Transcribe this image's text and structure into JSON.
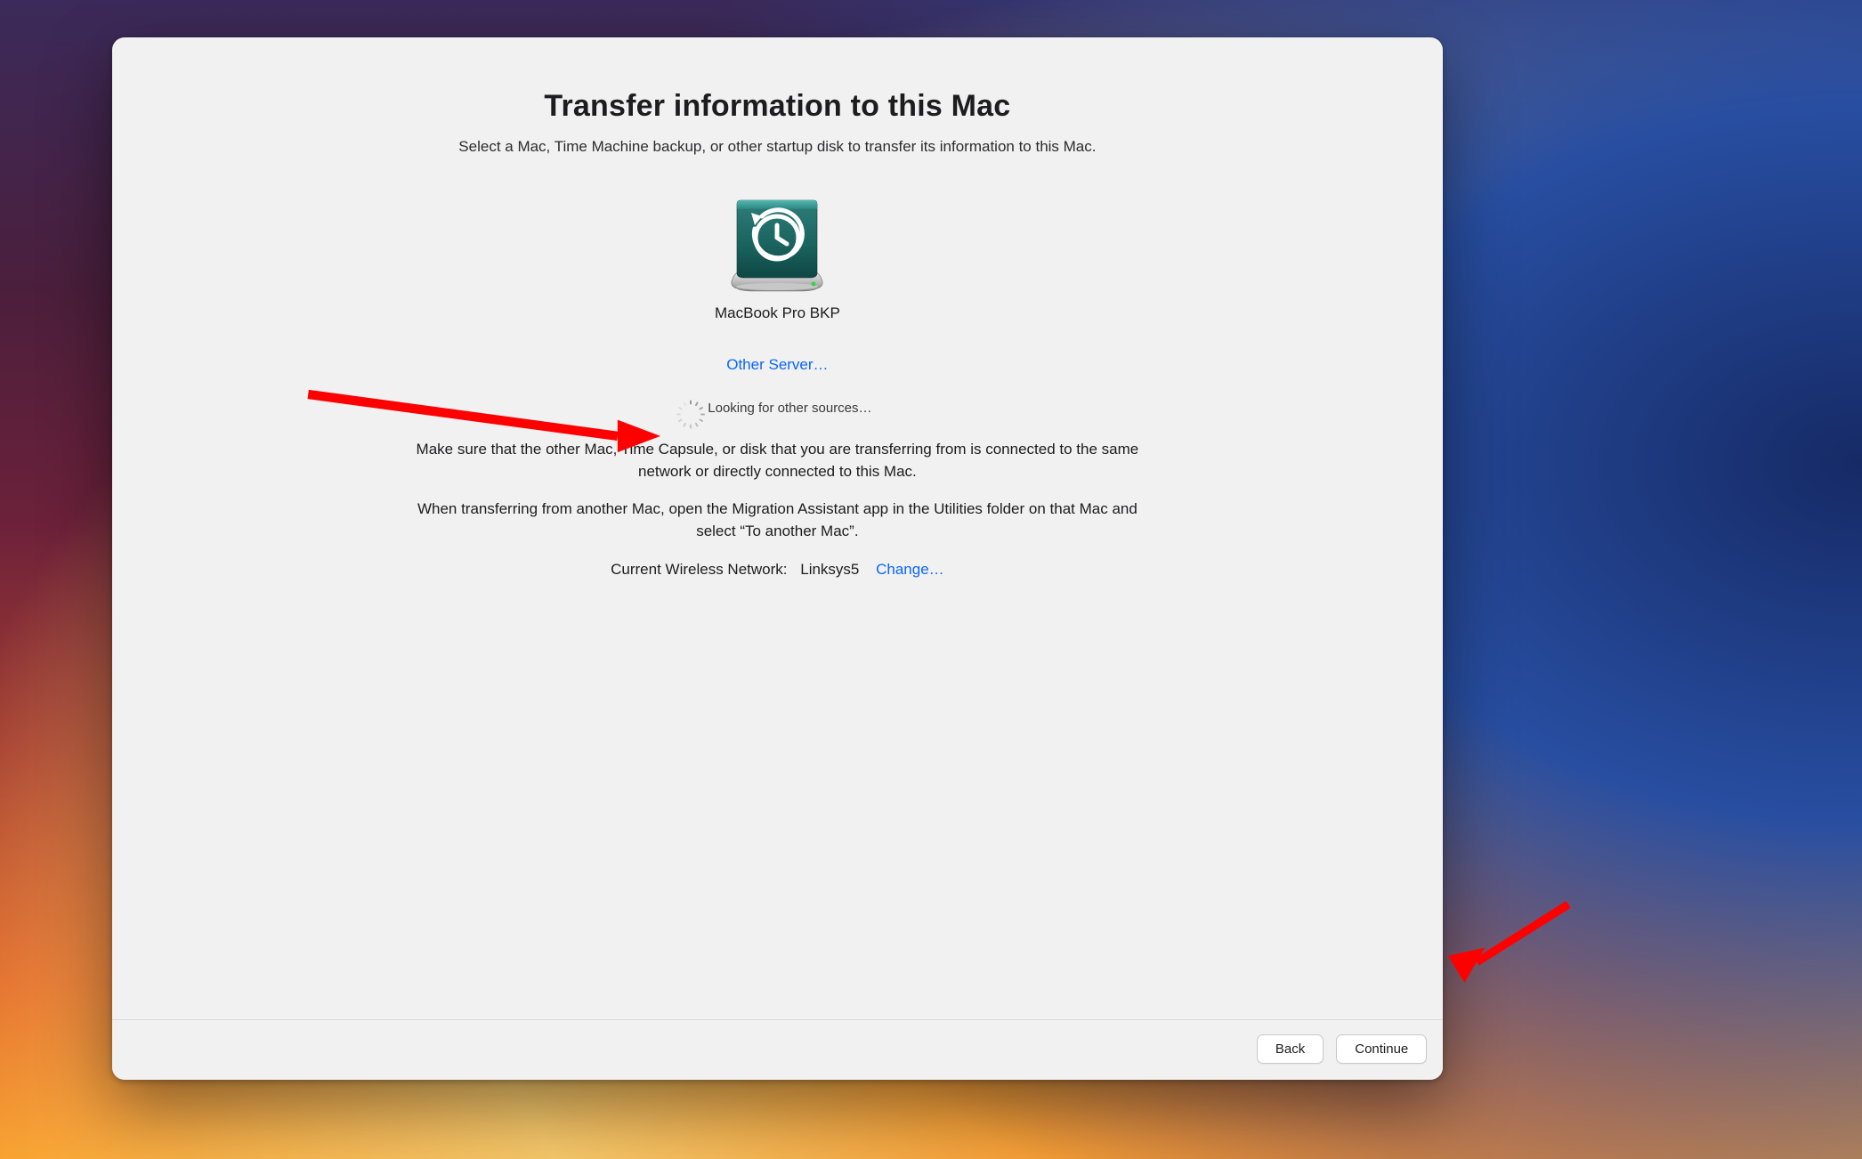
{
  "header": {
    "title": "Transfer information to this Mac",
    "subtitle": "Select a Mac, Time Machine backup, or other startup disk to transfer its information to this Mac."
  },
  "source": {
    "label": "MacBook Pro BKP",
    "icon_name": "time-machine-disk-icon"
  },
  "links": {
    "other_server": "Other Server…",
    "change": "Change…"
  },
  "status": {
    "looking": "Looking for other sources…"
  },
  "help": {
    "line1": "Make sure that the other Mac, Time Capsule, or disk that you are transferring from is connected to the same network or directly connected to this Mac.",
    "line2": "When transferring from another Mac, open the Migration Assistant app in the Utilities folder on that Mac and select “To another Mac”."
  },
  "network": {
    "label": "Current Wireless Network:",
    "name": "Linksys5"
  },
  "footer": {
    "back": "Back",
    "continue": "Continue"
  },
  "colors": {
    "link": "#0a66ff",
    "window_bg": "#f1f1f1"
  }
}
